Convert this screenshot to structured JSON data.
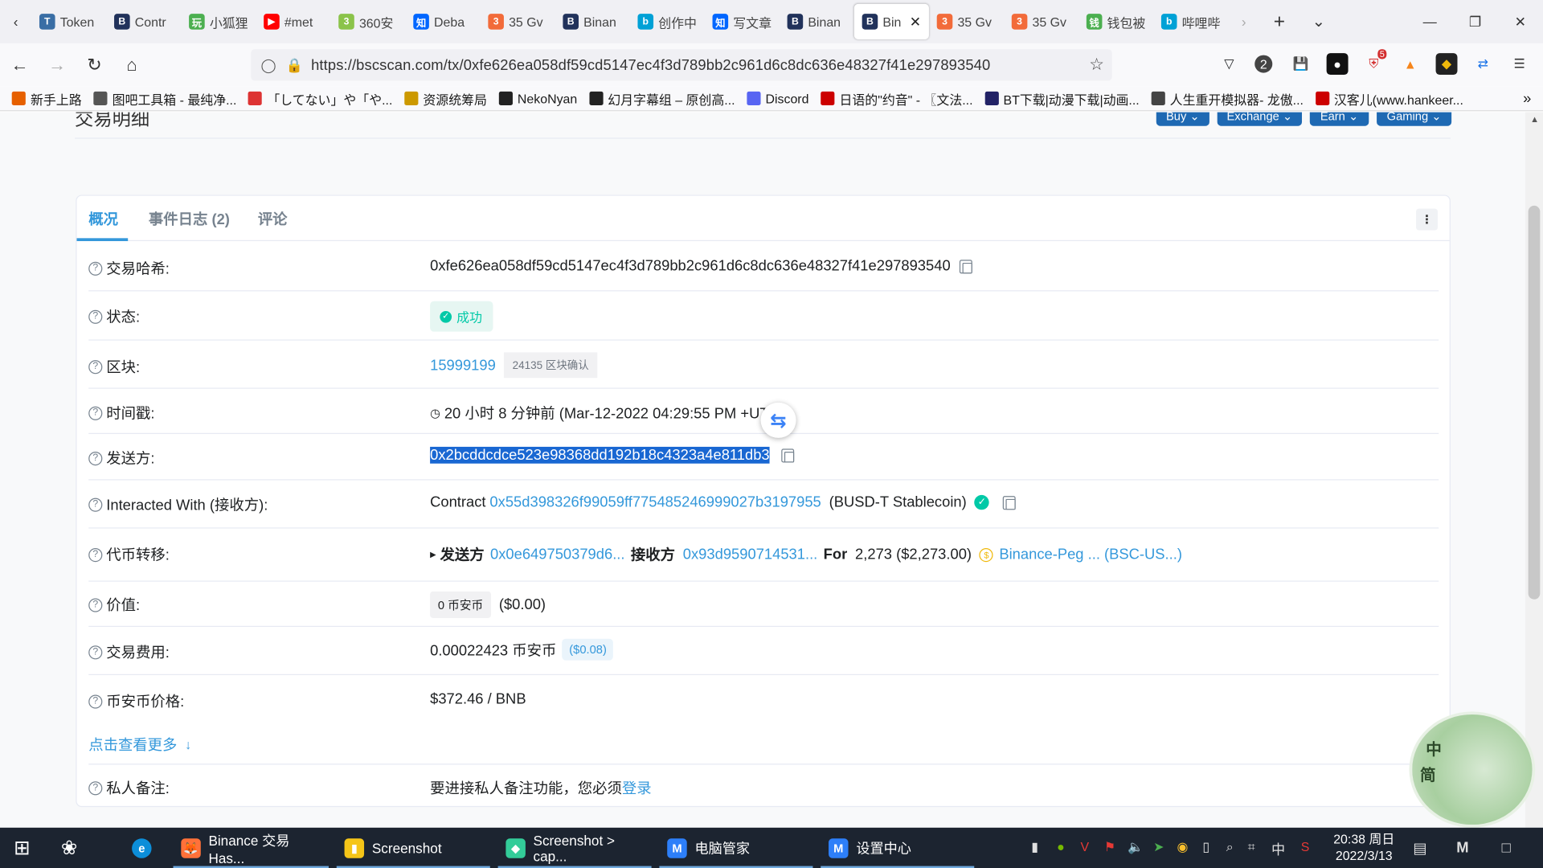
{
  "browser": {
    "tabs": [
      {
        "label": "Token",
        "fav": "T",
        "color": "#3a6ea5"
      },
      {
        "label": "Contr",
        "fav": "B",
        "color": "#21325b"
      },
      {
        "label": "小狐狸",
        "fav": "玩",
        "color": "#4caf50"
      },
      {
        "label": "#met",
        "fav": "▶",
        "color": "#ff0000"
      },
      {
        "label": "360安",
        "fav": "3",
        "color": "#8bc34a"
      },
      {
        "label": "Deba",
        "fav": "知",
        "color": "#0066ff"
      },
      {
        "label": "35 Gv",
        "fav": "3",
        "color": "#f26b3a"
      },
      {
        "label": "Binan",
        "fav": "B",
        "color": "#21325b"
      },
      {
        "label": "创作中",
        "fav": "b",
        "color": "#00a1d6"
      },
      {
        "label": "写文章",
        "fav": "知",
        "color": "#0066ff"
      },
      {
        "label": "Binan",
        "fav": "B",
        "color": "#21325b"
      },
      {
        "label": "Bin",
        "fav": "B",
        "color": "#21325b"
      },
      {
        "label": "35 Gv",
        "fav": "3",
        "color": "#f26b3a"
      },
      {
        "label": "35 Gv",
        "fav": "3",
        "color": "#f26b3a"
      },
      {
        "label": "钱包被",
        "fav": "钱",
        "color": "#4caf50"
      },
      {
        "label": "哔哩哔",
        "fav": "b",
        "color": "#00a1d6"
      }
    ],
    "active_tab_close": "✕",
    "new_tab": "+",
    "tab_list": "⌄",
    "url": "https://bscscan.com/tx/0xfe626ea058df59cd5147ec4f3d789bb2c961d6c8dc636e48327f41e297893540",
    "bookmarks": [
      {
        "label": "新手上路",
        "color": "#e66000"
      },
      {
        "label": "图吧工具箱 - 最纯净...",
        "color": "#555"
      },
      {
        "label": "「してない」や「や...",
        "color": "#d33"
      },
      {
        "label": "资源统筹局",
        "color": "#c90"
      },
      {
        "label": "NekoNyan",
        "color": "#222"
      },
      {
        "label": "幻月字幕组 – 原创高...",
        "color": "#222"
      },
      {
        "label": "Discord",
        "color": "#5865f2"
      },
      {
        "label": "日语的\"约音\" - 〖文法...",
        "color": "#c00"
      },
      {
        "label": "BT下载|动漫下载|动画...",
        "color": "#226"
      },
      {
        "label": "人生重开模拟器- 龙傲...",
        "color": "#444"
      },
      {
        "label": "汉客儿(www.hankeer...",
        "color": "#c00"
      }
    ],
    "ext_badge_count": "2",
    "ext_badge_5": "5"
  },
  "page": {
    "title": "交易明细",
    "header_buttons": [
      "Buy ⌄",
      "Exchange ⌄",
      "Earn ⌄",
      "Gaming ⌄"
    ],
    "tabs": [
      "概况",
      "事件日志 (2)",
      "评论"
    ],
    "rows": {
      "hash": {
        "label": "交易哈希:",
        "value": "0xfe626ea058df59cd5147ec4f3d789bb2c961d6c8dc636e48327f41e297893540"
      },
      "status": {
        "label": "状态:",
        "value": "成功"
      },
      "block": {
        "label": "区块:",
        "value": "15999199",
        "confirm": "24135 区块确认"
      },
      "timestamp": {
        "label": "时间戳:",
        "value": "20 小时 8 分钟前 (Mar-12-2022 04:29:55 PM +UTC)"
      },
      "from": {
        "label": "发送方:",
        "value": "0x2bcddcdce523e98368dd192b18c4323a4e811db3"
      },
      "to": {
        "label": "Interacted With (接收方):",
        "prefix": "Contract",
        "address": "0x55d398326f99059ff775485246999027b3197955",
        "name": "(BUSD-T Stablecoin)"
      },
      "transfer": {
        "label": "代币转移:",
        "from_label": "发送方",
        "from": "0x0e649750379d6...",
        "to_label": "接收方",
        "to": "0x93d9590714531...",
        "for_label": "For",
        "amount": "2,273 ($2,273.00)",
        "token": "Binance-Peg ... (BSC-US...)"
      },
      "value": {
        "label": "价值:",
        "badge": "0 币安币",
        "usd": "($0.00)"
      },
      "fee": {
        "label": "交易费用:",
        "value": "0.00022423 币安币",
        "usd": "($0.08)"
      },
      "price": {
        "label": "币安币价格:",
        "value": "$372.46 / BNB"
      },
      "more": "点击查看更多",
      "note": {
        "label": "私人备注:",
        "text": "要进接私人备注功能，您必须",
        "link": "登录"
      }
    },
    "deco_chars": [
      "中",
      "简"
    ]
  },
  "taskbar": {
    "apps": [
      {
        "label": "Binance 交易 Has...",
        "icon": "🦊",
        "color": "#ff7139"
      },
      {
        "label": "Screenshot",
        "icon": "▮",
        "color": "#f5c518"
      },
      {
        "label": "Screenshot > cap...",
        "icon": "◆",
        "color": "#3c9"
      },
      {
        "label": "电脑管家",
        "icon": "M",
        "color": "#2d7ff9"
      },
      {
        "label": "设置中心",
        "icon": "M",
        "color": "#2d7ff9"
      }
    ],
    "ime": "中",
    "time": "20:38 周日",
    "date": "2022/3/13"
  }
}
